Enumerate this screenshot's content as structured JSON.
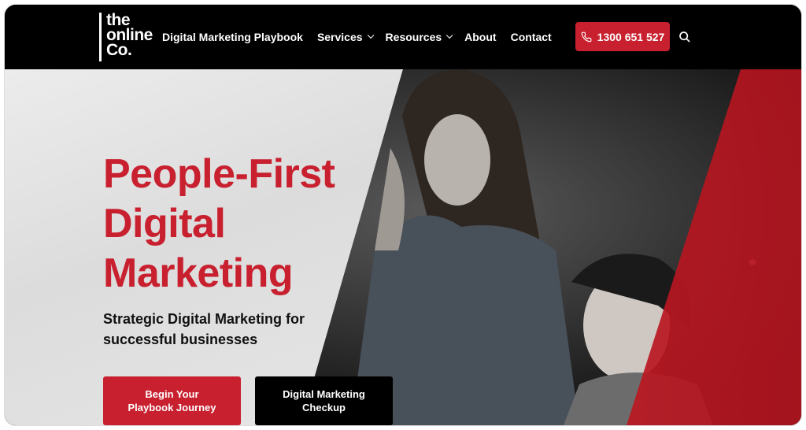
{
  "logo": {
    "line1": "the",
    "line2": "online",
    "line3": "Co."
  },
  "nav": {
    "playbook": "Digital Marketing Playbook",
    "services": "Services",
    "resources": "Resources",
    "about": "About",
    "contact": "Contact"
  },
  "phone": {
    "label": "1300 651 527"
  },
  "hero": {
    "headline_1": "People-First",
    "headline_2": "Digital",
    "headline_3": "Marketing",
    "subtitle_1": "Strategic Digital Marketing for",
    "subtitle_2": "successful businesses",
    "cta_primary_1": "Begin Your",
    "cta_primary_2": "Playbook Journey",
    "cta_secondary_1": "Digital Marketing",
    "cta_secondary_2": "Checkup"
  },
  "colors": {
    "brand_red": "#c8202f",
    "navbar": "#000000"
  },
  "icons": {
    "phone": "phone-icon",
    "search": "search-icon",
    "chevron": "chevron-down-icon"
  }
}
